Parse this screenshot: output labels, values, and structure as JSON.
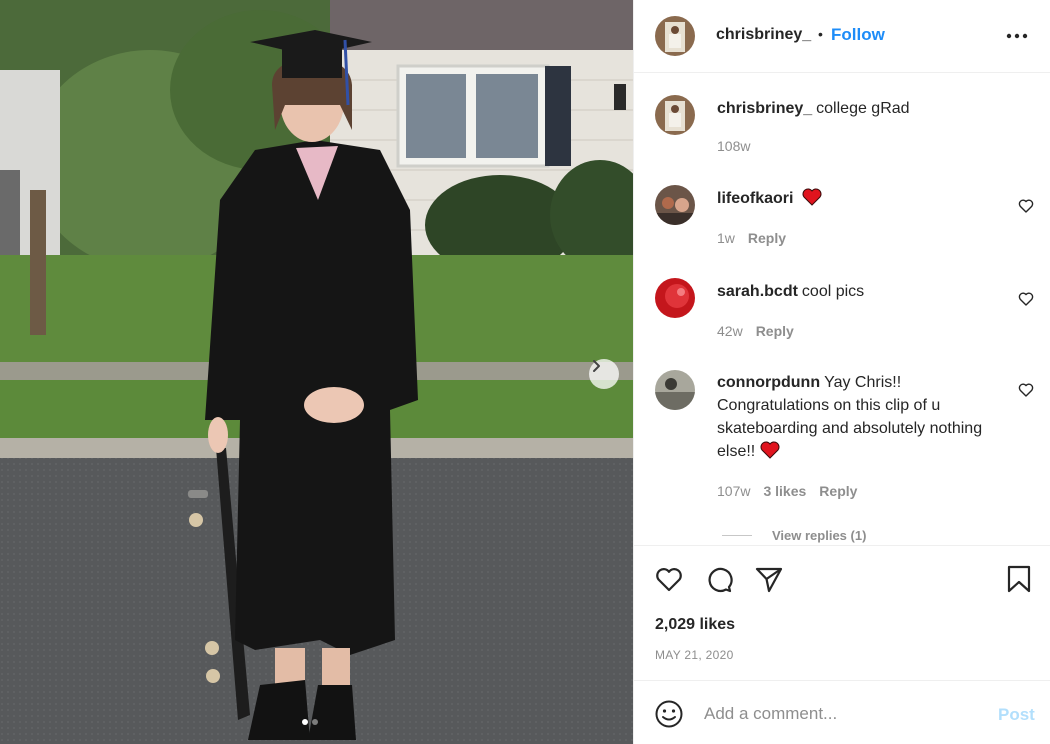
{
  "post": {
    "author": "chrisbriney_",
    "follow_label": "Follow",
    "separator": "•",
    "caption": {
      "username": "chrisbriney_",
      "text": "college gRad",
      "age": "108w"
    },
    "comments": [
      {
        "username": "lifeofkaori",
        "text": "",
        "emoji": "red-heart",
        "age": "1w",
        "likes": "",
        "reply_label": "Reply",
        "avatar_color": "#6b5548"
      },
      {
        "username": "sarah.bcdt",
        "text": "cool pics",
        "emoji": "",
        "age": "42w",
        "likes": "",
        "reply_label": "Reply",
        "avatar_color": "#c4161c"
      },
      {
        "username": "connorpdunn",
        "text": "Yay Chris!! Congratulations on this clip of u skateboarding and absolutely nothing else!!",
        "emoji": "red-heart",
        "age": "107w",
        "likes": "3 likes",
        "reply_label": "Reply",
        "avatar_color": "#8a8a80"
      }
    ],
    "view_replies": "View replies (1)",
    "likes": "2,029 likes",
    "date": "MAY 21, 2020",
    "comment_placeholder": "Add a comment...",
    "post_label": "Post"
  },
  "carousel": {
    "current": 1,
    "total": 2
  },
  "colors": {
    "link_blue": "#1d8cf8",
    "post_disabled": "#b2dffc",
    "muted": "#8e8e8e",
    "heart_red": "#ed4956"
  },
  "icons": [
    "more-icon",
    "heart-icon",
    "comment-icon",
    "share-icon",
    "bookmark-icon",
    "emoji-icon",
    "chevron-right-icon"
  ]
}
